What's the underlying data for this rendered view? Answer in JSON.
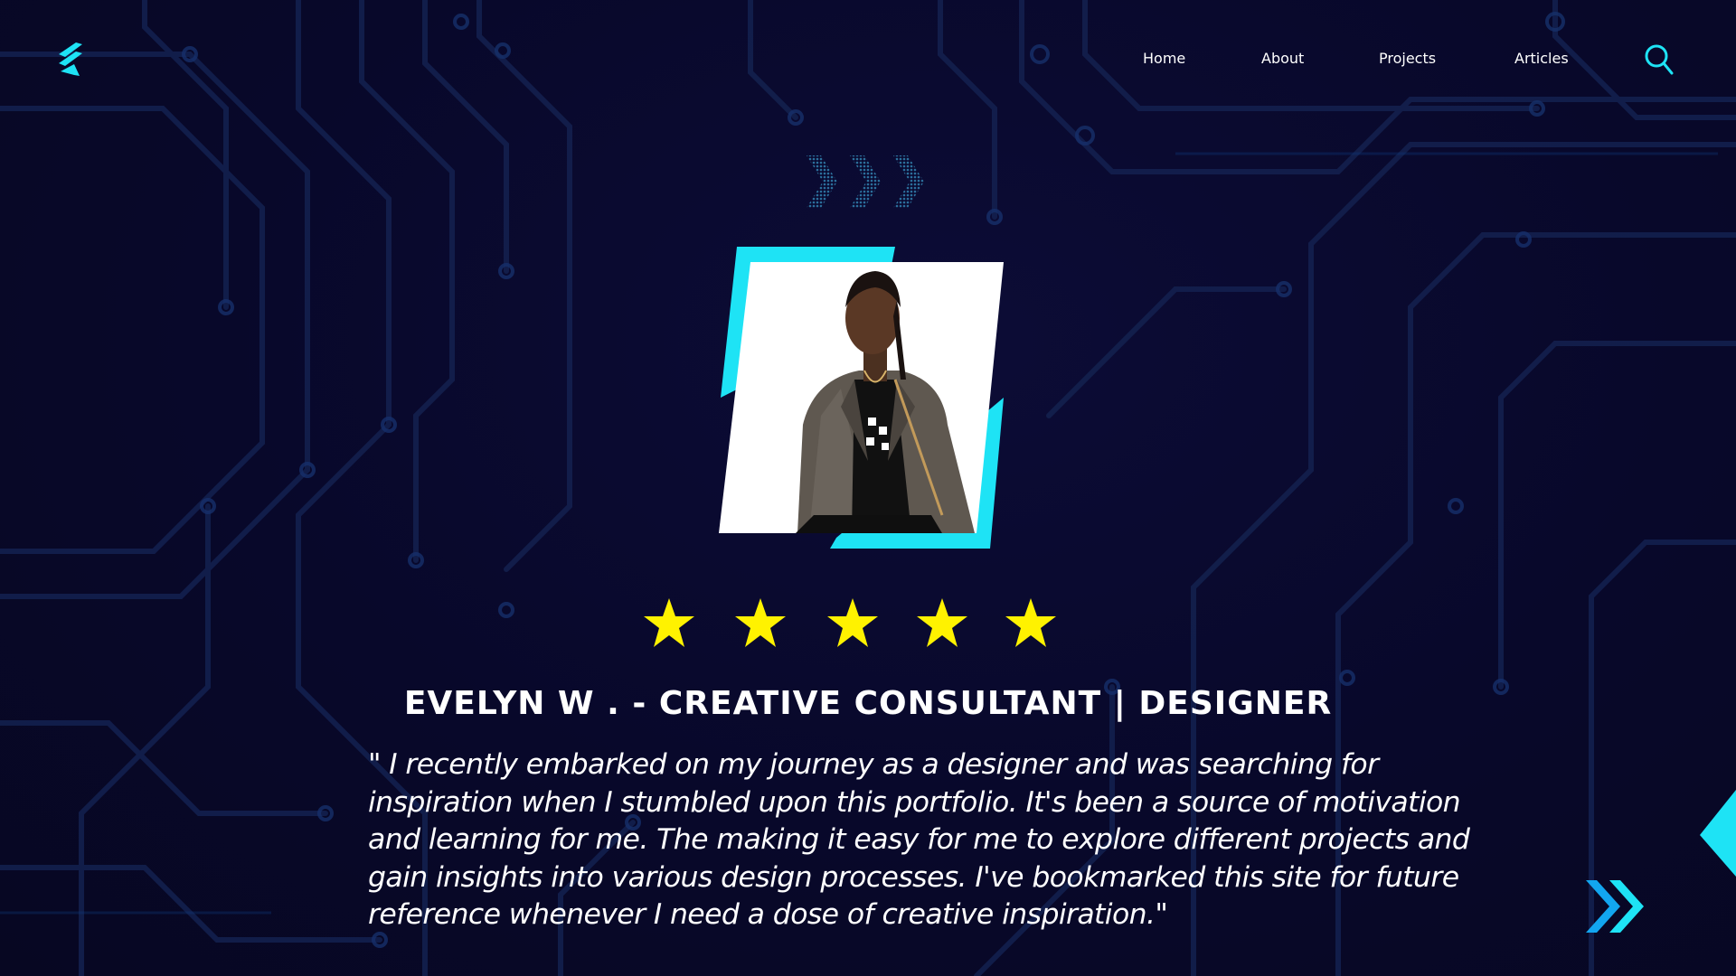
{
  "header": {
    "logo_icon": "lightning-stripes-logo",
    "nav": [
      {
        "label": "Home"
      },
      {
        "label": "About"
      },
      {
        "label": "Projects"
      },
      {
        "label": "Articles"
      }
    ],
    "search_icon": "search-icon"
  },
  "testimonial": {
    "rating": 5,
    "rating_max": 5,
    "reviewer": "EVELYN W . - CREATIVE CONSULTANT | DESIGNER",
    "quote_lines": [
      "\" I recently embarked on my journey as a designer and was searching for",
      "inspiration when I stumbled upon this portfolio. It's been a source of motivation",
      "and learning for me. The making it easy for me to explore different projects and",
      "gain insights into various design processes. I've bookmarked this site for future",
      "reference whenever I need a dose of creative inspiration.\""
    ],
    "next_icon": "double-chevron-right-icon"
  },
  "colors": {
    "background": "#0a0a28",
    "accent_cyan": "#1ee3f5",
    "accent_blue": "#12a6f0",
    "star_yellow": "#fff200",
    "text": "#ffffff"
  }
}
